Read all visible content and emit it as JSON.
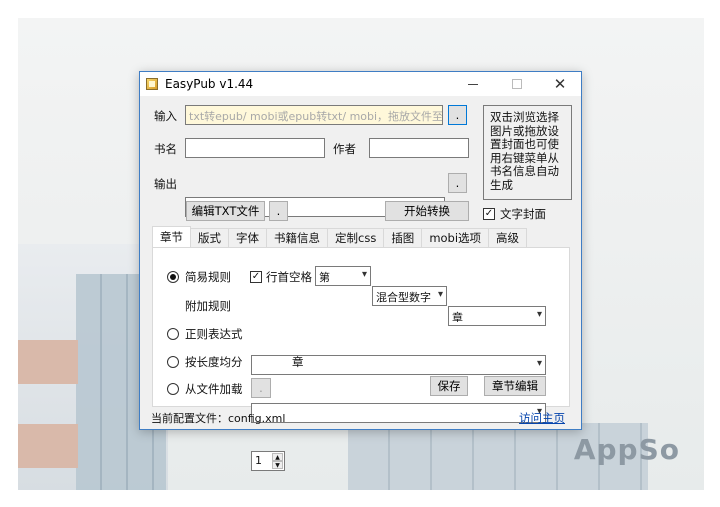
{
  "window": {
    "title": "EasyPub v1.44"
  },
  "form": {
    "input_label": "输入",
    "input_placeholder": "txt转epub/ mobi或epub转txt/ mobi，拖放文件至此",
    "browse_label": ".",
    "title_label": "书名",
    "author_label": "作者",
    "output_label": "输出",
    "output_browse_label": "."
  },
  "cover_notice": "双击浏览选择图片或拖放设置封面也可使用右键菜单从书名信息自动生成",
  "text_cover": {
    "label": "文字封面",
    "checked": true
  },
  "buttons": {
    "edit_txt": "编辑TXT文件",
    "edit_dot": ".",
    "start": "开始转换",
    "save": "保存",
    "chapter_edit": "章节编辑",
    "load_dot": "."
  },
  "tabs": [
    "章节",
    "版式",
    "字体",
    "书籍信息",
    "定制css",
    "插图",
    "mobi选项",
    "高级"
  ],
  "chapter_panel": {
    "simple_rule_label": "简易规则",
    "line_space_label": "行首空格",
    "line_space_checked": true,
    "combo_prefix": "第",
    "combo_number": "混合型数字",
    "combo_suffix": "章",
    "extra_rule_label": "附加规则",
    "regex_label": "正则表达式",
    "by_length_label": "按长度均分",
    "length_value": "1",
    "length_unit": "章",
    "from_file_label": "从文件加载"
  },
  "status": {
    "config_text": "当前配置文件：config.xml",
    "homepage_link": "访问主页"
  },
  "watermark": "AppSo"
}
